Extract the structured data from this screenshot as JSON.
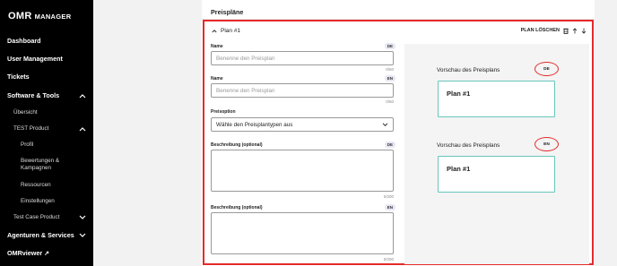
{
  "brand": {
    "logo": "OMR",
    "subtitle": "MANAGER"
  },
  "sidebar": {
    "items": [
      {
        "label": "Dashboard"
      },
      {
        "label": "User Management"
      },
      {
        "label": "Tickets"
      },
      {
        "label": "Software & Tools",
        "expanded": true
      },
      {
        "label": "Übersicht"
      },
      {
        "label": "TEST Product",
        "expanded": true
      },
      {
        "label": "Profil"
      },
      {
        "label": "Bewertungen & Kampagnen"
      },
      {
        "label": "Ressourcen"
      },
      {
        "label": "Einstellungen"
      },
      {
        "label": "Test Case Product",
        "expanded": false
      },
      {
        "label": "Agenturen & Services",
        "expanded": false
      },
      {
        "label": "OMRviewer ↗"
      }
    ]
  },
  "main": {
    "section_title": "Preispläne",
    "plan": {
      "title": "Plan #1",
      "delete_label": "PLAN LÖSCHEN",
      "fields": {
        "name_de": {
          "label": "Name",
          "badge": "DE",
          "placeholder": "Benenne den Preisplan",
          "count": "0/50"
        },
        "name_en": {
          "label": "Name",
          "badge": "EN",
          "placeholder": "Benenne den Preisplan",
          "count": "0/50"
        },
        "option": {
          "label": "Preisoption",
          "value": "Wähle den Preisplantypen aus"
        },
        "desc_de": {
          "label": "Beschreibung (optional)",
          "badge": "DE",
          "count": "0/200"
        },
        "desc_en": {
          "label": "Beschreibung (optional)",
          "badge": "EN",
          "count": "0/200"
        }
      },
      "preview": {
        "de": {
          "label": "Vorschau des Preisplans",
          "lang": "DE",
          "card_title": "Plan #1"
        },
        "en": {
          "label": "Vorschau des Preisplans",
          "lang": "EN",
          "card_title": "Plan #1"
        }
      }
    }
  },
  "colors": {
    "highlight": "#e52a2a",
    "preview_border": "#68c6bd",
    "sidebar_bg": "#000000"
  }
}
